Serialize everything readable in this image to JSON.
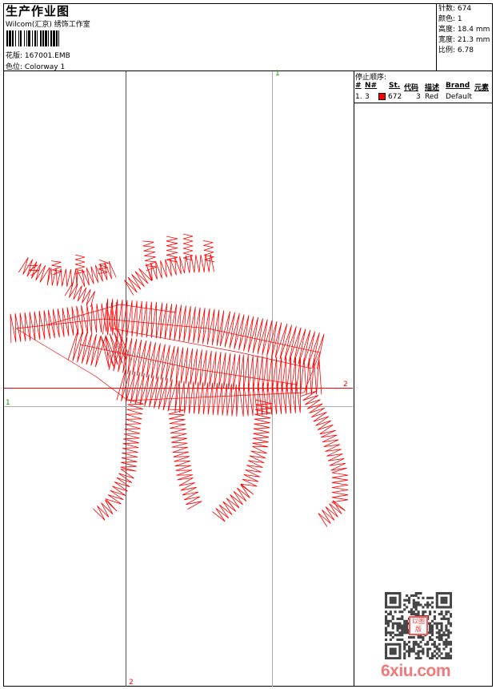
{
  "header": {
    "title": "生产作业图",
    "company": "Wilcom(汇京) 绣饰工作室",
    "design_label": "花版:",
    "design_value": "167001.EMB",
    "colorway_label": "色位:",
    "colorway_value": "Colorway 1"
  },
  "info": {
    "stitches_label": "针数:",
    "stitches_value": "674",
    "colors_label": "颜色:",
    "colors_value": "1",
    "height_label": "高度:",
    "height_value": "18.4 mm",
    "width_label": "宽度:",
    "width_value": "21.3 mm",
    "scale_label": "比例:",
    "scale_value": "6.78"
  },
  "stop_sequence": {
    "title": "停止顺序:",
    "columns": [
      "#",
      "N#",
      "St.",
      "代码",
      "描述",
      "Brand",
      "元素"
    ],
    "rows": [
      {
        "index": "1.",
        "needle": "3",
        "swatch_color": "#ff0000",
        "stitches": "672",
        "code": "3",
        "description": "Red",
        "brand": "Default"
      }
    ]
  },
  "guides": {
    "v1_label": "1",
    "h2_label": "2",
    "h1_label": "1",
    "v2_label": "2",
    "guide_green": "#00aa00",
    "guide_red": "#ff0000"
  },
  "design": {
    "thread_color": "#ff0000"
  },
  "watermark": {
    "logo_text": "6xiu.com",
    "seal_text": "以图版"
  }
}
